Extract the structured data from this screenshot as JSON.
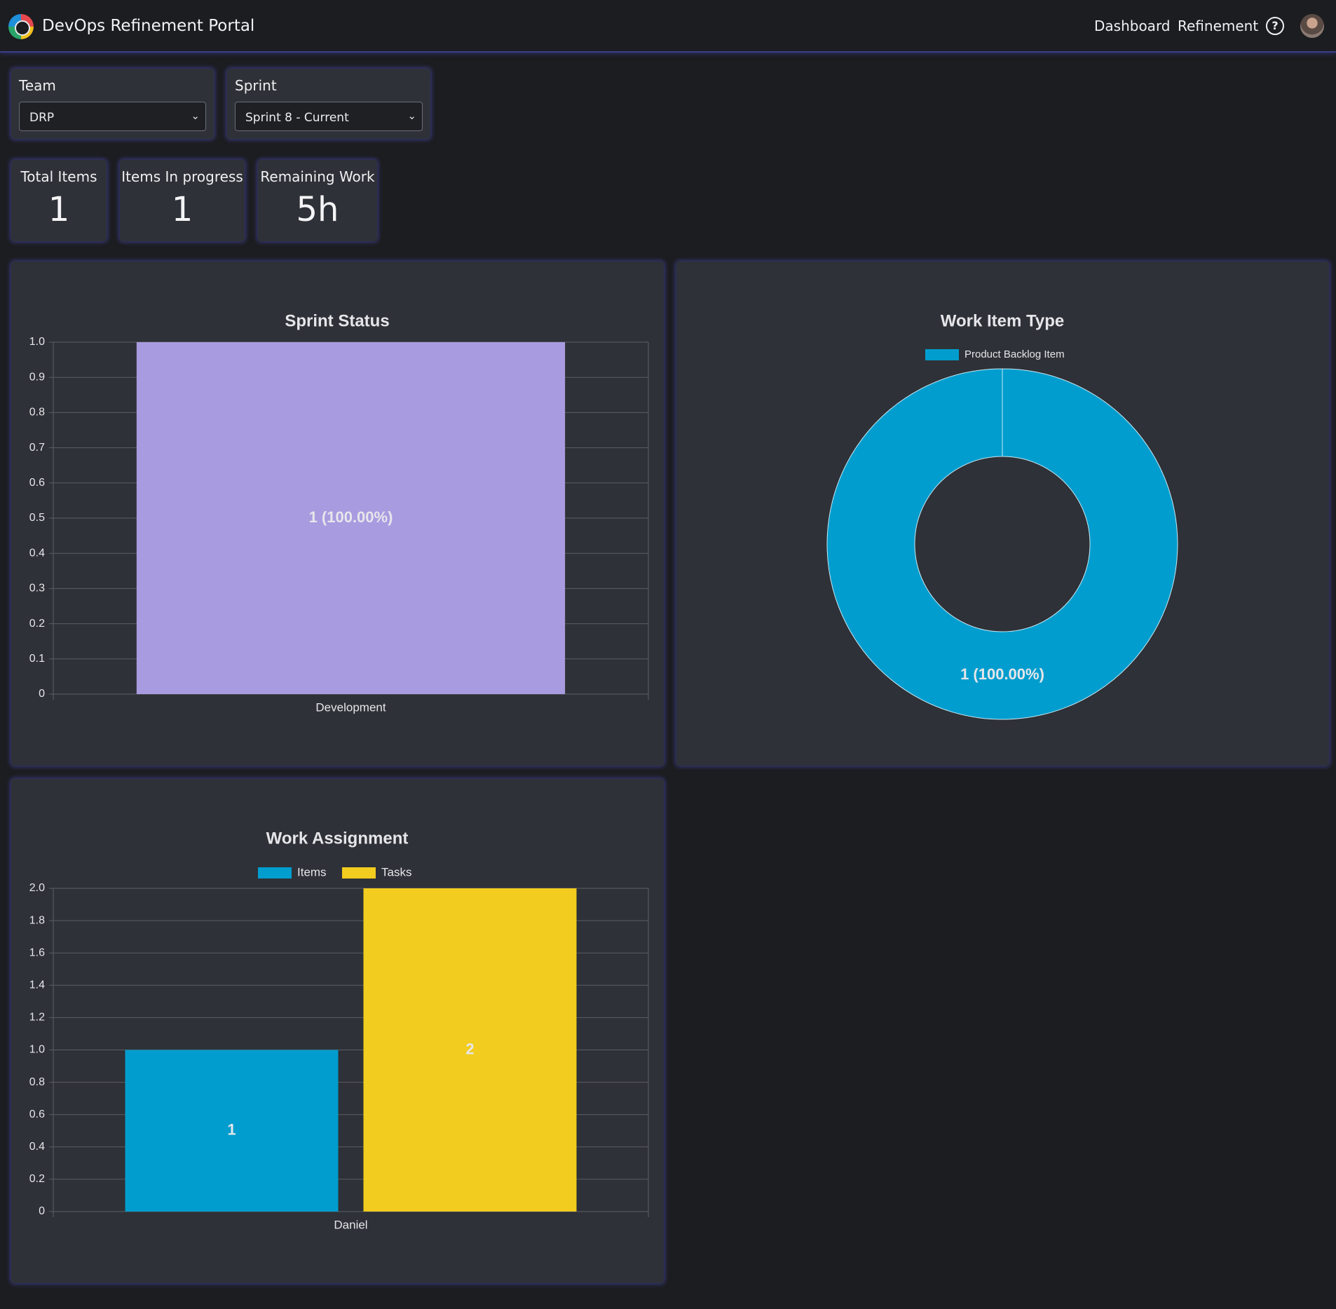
{
  "header": {
    "title": "DevOps Refinement Portal",
    "nav": {
      "dashboard": "Dashboard",
      "refinement": "Refinement"
    },
    "help_icon": "?"
  },
  "filters": {
    "team": {
      "label": "Team",
      "value": "DRP"
    },
    "sprint": {
      "label": "Sprint",
      "value": "Sprint 8 - Current"
    }
  },
  "stats": {
    "total_items": {
      "label": "Total Items",
      "value": "1"
    },
    "in_progress": {
      "label": "Items In progress",
      "value": "1"
    },
    "remaining_work": {
      "label": "Remaining Work",
      "value": "5h"
    }
  },
  "chart_data": [
    {
      "type": "bar",
      "title": "Sprint Status",
      "categories": [
        "Development"
      ],
      "series": [
        {
          "values": [
            1
          ],
          "color": "#a99be0"
        }
      ],
      "data_labels": [
        "1 (100.00%)"
      ],
      "ylim": [
        0,
        1
      ],
      "yticks": [
        "0",
        "0.1",
        "0.2",
        "0.3",
        "0.4",
        "0.5",
        "0.6",
        "0.7",
        "0.8",
        "0.9",
        "1.0"
      ],
      "grid": true
    },
    {
      "type": "pie",
      "variant": "doughnut",
      "title": "Work Item Type",
      "labels": [
        "Product Backlog Item"
      ],
      "values": [
        1
      ],
      "colors": [
        "#009dce"
      ],
      "data_labels": [
        "1 (100.00%)"
      ],
      "legend": "top"
    },
    {
      "type": "bar",
      "title": "Work Assignment",
      "categories": [
        "Daniel"
      ],
      "series": [
        {
          "name": "Items",
          "values": [
            1
          ],
          "color": "#009dce"
        },
        {
          "name": "Tasks",
          "values": [
            2
          ],
          "color": "#f2cc1e"
        }
      ],
      "data_labels": [
        "1",
        "2"
      ],
      "ylim": [
        0,
        2
      ],
      "yticks": [
        "0",
        "0.2",
        "0.4",
        "0.6",
        "0.8",
        "1.0",
        "1.2",
        "1.4",
        "1.6",
        "1.8",
        "2.0"
      ],
      "legend": "top",
      "grid": true
    }
  ]
}
